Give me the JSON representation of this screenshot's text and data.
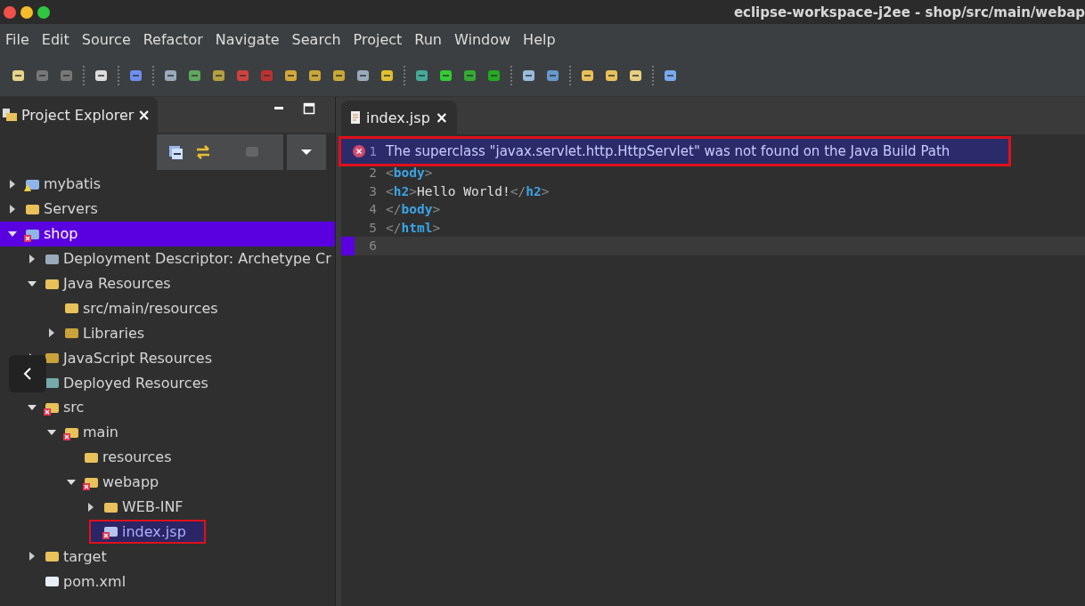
{
  "window": {
    "title": "eclipse-workspace-j2ee - shop/src/main/webap"
  },
  "menu": [
    "File",
    "Edit",
    "Source",
    "Refactor",
    "Navigate",
    "Search",
    "Project",
    "Run",
    "Window",
    "Help"
  ],
  "explorer": {
    "title": "Project Explorer",
    "close": "×",
    "tree": [
      {
        "label": "mybatis",
        "kind": "project",
        "expanded": false,
        "selected": false,
        "error": false,
        "warning": true,
        "highlighted": false
      },
      {
        "label": "Servers",
        "kind": "folder",
        "expanded": false,
        "selected": false,
        "error": false,
        "warning": false,
        "highlighted": false
      },
      {
        "label": "shop",
        "kind": "project",
        "expanded": true,
        "selected": true,
        "error": true,
        "warning": false,
        "highlighted": false,
        "children": [
          {
            "label": "Deployment Descriptor: Archetype Cr",
            "kind": "descriptor",
            "expanded": false,
            "selected": false,
            "error": false,
            "warning": false,
            "highlighted": false
          },
          {
            "label": "Java Resources",
            "kind": "resources",
            "expanded": true,
            "selected": false,
            "error": false,
            "warning": false,
            "highlighted": false,
            "children": [
              {
                "label": "src/main/resources",
                "kind": "package",
                "selected": false,
                "error": false,
                "warning": false,
                "highlighted": false
              },
              {
                "label": "Libraries",
                "kind": "library",
                "expanded": false,
                "selected": false,
                "error": false,
                "warning": false,
                "highlighted": false
              }
            ]
          },
          {
            "label": "JavaScript Resources",
            "kind": "library",
            "expanded": false,
            "selected": false,
            "error": false,
            "warning": false,
            "highlighted": false
          },
          {
            "label": "Deployed Resources",
            "kind": "deployed",
            "selected": false,
            "error": false,
            "warning": false,
            "highlighted": false
          },
          {
            "label": "src",
            "kind": "folder",
            "expanded": true,
            "selected": false,
            "error": true,
            "warning": false,
            "highlighted": false,
            "children": [
              {
                "label": "main",
                "kind": "folder",
                "expanded": true,
                "selected": false,
                "error": true,
                "warning": false,
                "highlighted": false,
                "children": [
                  {
                    "label": "resources",
                    "kind": "folder",
                    "selected": false,
                    "error": false,
                    "warning": false,
                    "highlighted": false
                  },
                  {
                    "label": "webapp",
                    "kind": "folder",
                    "expanded": true,
                    "selected": false,
                    "error": true,
                    "warning": false,
                    "highlighted": false,
                    "children": [
                      {
                        "label": "WEB-INF",
                        "kind": "folder",
                        "expanded": false,
                        "selected": false,
                        "error": false,
                        "warning": false,
                        "highlighted": false
                      },
                      {
                        "label": "index.jsp",
                        "kind": "jsp",
                        "selected": false,
                        "error": true,
                        "warning": false,
                        "highlighted": true
                      }
                    ]
                  }
                ]
              }
            ]
          },
          {
            "label": "target",
            "kind": "folder",
            "expanded": false,
            "selected": false,
            "error": false,
            "warning": false,
            "highlighted": false
          },
          {
            "label": "pom.xml",
            "kind": "xml",
            "selected": false,
            "error": false,
            "warning": false,
            "highlighted": false
          }
        ]
      }
    ]
  },
  "editor": {
    "tab": {
      "label": "index.jsp",
      "close": "×",
      "selected": true
    },
    "error_message": "The superclass \"javax.servlet.http.HttpServlet\" was not found on the Java Build Path",
    "lines": [
      {
        "number": "1",
        "error": true,
        "current": false
      },
      {
        "number": "2",
        "error": false,
        "current": false,
        "tokens": [
          {
            "kind": "bracket",
            "text": "<"
          },
          {
            "kind": "tag",
            "text": "body"
          },
          {
            "kind": "bracket",
            "text": ">"
          }
        ]
      },
      {
        "number": "3",
        "error": false,
        "current": false,
        "tokens": [
          {
            "kind": "bracket",
            "text": "<"
          },
          {
            "kind": "tag",
            "text": "h2"
          },
          {
            "kind": "bracket",
            "text": ">"
          },
          {
            "kind": "text",
            "text": "Hello World!"
          },
          {
            "kind": "bracket",
            "text": "</"
          },
          {
            "kind": "tag",
            "text": "h2"
          },
          {
            "kind": "bracket",
            "text": ">"
          }
        ]
      },
      {
        "number": "4",
        "error": false,
        "current": false,
        "tokens": [
          {
            "kind": "bracket",
            "text": "</"
          },
          {
            "kind": "tag",
            "text": "body"
          },
          {
            "kind": "bracket",
            "text": ">"
          }
        ]
      },
      {
        "number": "5",
        "error": false,
        "current": false,
        "tokens": [
          {
            "kind": "bracket",
            "text": "</"
          },
          {
            "kind": "tag",
            "text": "html"
          },
          {
            "kind": "bracket",
            "text": ">"
          }
        ]
      },
      {
        "number": "6",
        "error": false,
        "current": true
      }
    ]
  }
}
